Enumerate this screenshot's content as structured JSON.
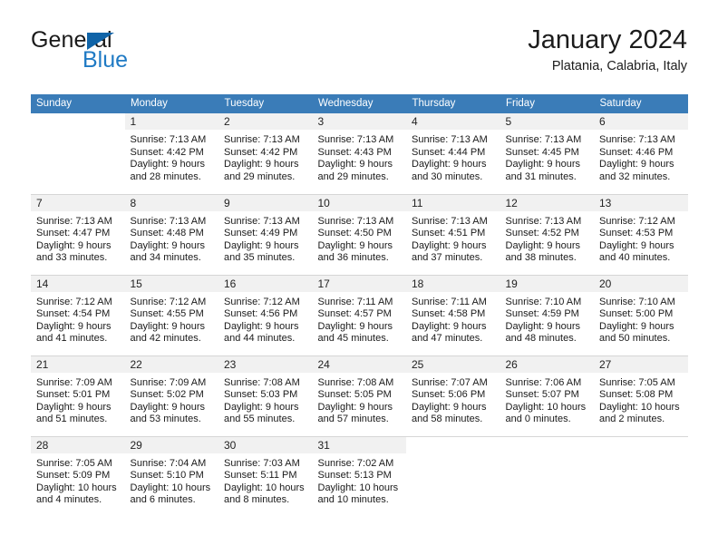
{
  "brand": {
    "word1": "General",
    "word2": "Blue",
    "triangle_color": "#1064a8",
    "blue_color": "#1f7ac4"
  },
  "header": {
    "title": "January 2024",
    "subtitle": "Platania, Calabria, Italy"
  },
  "theme": {
    "header_bg": "#3a7cb8",
    "header_text": "#ffffff",
    "daynum_bg": "#f1f1f1",
    "grid_line": "#d6d6d6"
  },
  "weekdays": [
    "Sunday",
    "Monday",
    "Tuesday",
    "Wednesday",
    "Thursday",
    "Friday",
    "Saturday"
  ],
  "labels": {
    "sunrise_prefix": "Sunrise: ",
    "sunset_prefix": "Sunset: ",
    "daylight_prefix": "Daylight: "
  },
  "weeks": [
    [
      {
        "blank": true,
        "day": "",
        "l1": "",
        "l2": "",
        "l3": "",
        "l4": ""
      },
      {
        "day": "1",
        "l1": "Sunrise: 7:13 AM",
        "l2": "Sunset: 4:42 PM",
        "l3": "Daylight: 9 hours",
        "l4": "and 28 minutes."
      },
      {
        "day": "2",
        "l1": "Sunrise: 7:13 AM",
        "l2": "Sunset: 4:42 PM",
        "l3": "Daylight: 9 hours",
        "l4": "and 29 minutes."
      },
      {
        "day": "3",
        "l1": "Sunrise: 7:13 AM",
        "l2": "Sunset: 4:43 PM",
        "l3": "Daylight: 9 hours",
        "l4": "and 29 minutes."
      },
      {
        "day": "4",
        "l1": "Sunrise: 7:13 AM",
        "l2": "Sunset: 4:44 PM",
        "l3": "Daylight: 9 hours",
        "l4": "and 30 minutes."
      },
      {
        "day": "5",
        "l1": "Sunrise: 7:13 AM",
        "l2": "Sunset: 4:45 PM",
        "l3": "Daylight: 9 hours",
        "l4": "and 31 minutes."
      },
      {
        "day": "6",
        "l1": "Sunrise: 7:13 AM",
        "l2": "Sunset: 4:46 PM",
        "l3": "Daylight: 9 hours",
        "l4": "and 32 minutes."
      }
    ],
    [
      {
        "day": "7",
        "l1": "Sunrise: 7:13 AM",
        "l2": "Sunset: 4:47 PM",
        "l3": "Daylight: 9 hours",
        "l4": "and 33 minutes."
      },
      {
        "day": "8",
        "l1": "Sunrise: 7:13 AM",
        "l2": "Sunset: 4:48 PM",
        "l3": "Daylight: 9 hours",
        "l4": "and 34 minutes."
      },
      {
        "day": "9",
        "l1": "Sunrise: 7:13 AM",
        "l2": "Sunset: 4:49 PM",
        "l3": "Daylight: 9 hours",
        "l4": "and 35 minutes."
      },
      {
        "day": "10",
        "l1": "Sunrise: 7:13 AM",
        "l2": "Sunset: 4:50 PM",
        "l3": "Daylight: 9 hours",
        "l4": "and 36 minutes."
      },
      {
        "day": "11",
        "l1": "Sunrise: 7:13 AM",
        "l2": "Sunset: 4:51 PM",
        "l3": "Daylight: 9 hours",
        "l4": "and 37 minutes."
      },
      {
        "day": "12",
        "l1": "Sunrise: 7:13 AM",
        "l2": "Sunset: 4:52 PM",
        "l3": "Daylight: 9 hours",
        "l4": "and 38 minutes."
      },
      {
        "day": "13",
        "l1": "Sunrise: 7:12 AM",
        "l2": "Sunset: 4:53 PM",
        "l3": "Daylight: 9 hours",
        "l4": "and 40 minutes."
      }
    ],
    [
      {
        "day": "14",
        "l1": "Sunrise: 7:12 AM",
        "l2": "Sunset: 4:54 PM",
        "l3": "Daylight: 9 hours",
        "l4": "and 41 minutes."
      },
      {
        "day": "15",
        "l1": "Sunrise: 7:12 AM",
        "l2": "Sunset: 4:55 PM",
        "l3": "Daylight: 9 hours",
        "l4": "and 42 minutes."
      },
      {
        "day": "16",
        "l1": "Sunrise: 7:12 AM",
        "l2": "Sunset: 4:56 PM",
        "l3": "Daylight: 9 hours",
        "l4": "and 44 minutes."
      },
      {
        "day": "17",
        "l1": "Sunrise: 7:11 AM",
        "l2": "Sunset: 4:57 PM",
        "l3": "Daylight: 9 hours",
        "l4": "and 45 minutes."
      },
      {
        "day": "18",
        "l1": "Sunrise: 7:11 AM",
        "l2": "Sunset: 4:58 PM",
        "l3": "Daylight: 9 hours",
        "l4": "and 47 minutes."
      },
      {
        "day": "19",
        "l1": "Sunrise: 7:10 AM",
        "l2": "Sunset: 4:59 PM",
        "l3": "Daylight: 9 hours",
        "l4": "and 48 minutes."
      },
      {
        "day": "20",
        "l1": "Sunrise: 7:10 AM",
        "l2": "Sunset: 5:00 PM",
        "l3": "Daylight: 9 hours",
        "l4": "and 50 minutes."
      }
    ],
    [
      {
        "day": "21",
        "l1": "Sunrise: 7:09 AM",
        "l2": "Sunset: 5:01 PM",
        "l3": "Daylight: 9 hours",
        "l4": "and 51 minutes."
      },
      {
        "day": "22",
        "l1": "Sunrise: 7:09 AM",
        "l2": "Sunset: 5:02 PM",
        "l3": "Daylight: 9 hours",
        "l4": "and 53 minutes."
      },
      {
        "day": "23",
        "l1": "Sunrise: 7:08 AM",
        "l2": "Sunset: 5:03 PM",
        "l3": "Daylight: 9 hours",
        "l4": "and 55 minutes."
      },
      {
        "day": "24",
        "l1": "Sunrise: 7:08 AM",
        "l2": "Sunset: 5:05 PM",
        "l3": "Daylight: 9 hours",
        "l4": "and 57 minutes."
      },
      {
        "day": "25",
        "l1": "Sunrise: 7:07 AM",
        "l2": "Sunset: 5:06 PM",
        "l3": "Daylight: 9 hours",
        "l4": "and 58 minutes."
      },
      {
        "day": "26",
        "l1": "Sunrise: 7:06 AM",
        "l2": "Sunset: 5:07 PM",
        "l3": "Daylight: 10 hours",
        "l4": "and 0 minutes."
      },
      {
        "day": "27",
        "l1": "Sunrise: 7:05 AM",
        "l2": "Sunset: 5:08 PM",
        "l3": "Daylight: 10 hours",
        "l4": "and 2 minutes."
      }
    ],
    [
      {
        "day": "28",
        "l1": "Sunrise: 7:05 AM",
        "l2": "Sunset: 5:09 PM",
        "l3": "Daylight: 10 hours",
        "l4": "and 4 minutes."
      },
      {
        "day": "29",
        "l1": "Sunrise: 7:04 AM",
        "l2": "Sunset: 5:10 PM",
        "l3": "Daylight: 10 hours",
        "l4": "and 6 minutes."
      },
      {
        "day": "30",
        "l1": "Sunrise: 7:03 AM",
        "l2": "Sunset: 5:11 PM",
        "l3": "Daylight: 10 hours",
        "l4": "and 8 minutes."
      },
      {
        "day": "31",
        "l1": "Sunrise: 7:02 AM",
        "l2": "Sunset: 5:13 PM",
        "l3": "Daylight: 10 hours",
        "l4": "and 10 minutes."
      },
      {
        "blank": true,
        "day": "",
        "l1": "",
        "l2": "",
        "l3": "",
        "l4": ""
      },
      {
        "blank": true,
        "day": "",
        "l1": "",
        "l2": "",
        "l3": "",
        "l4": ""
      },
      {
        "blank": true,
        "day": "",
        "l1": "",
        "l2": "",
        "l3": "",
        "l4": ""
      }
    ]
  ]
}
